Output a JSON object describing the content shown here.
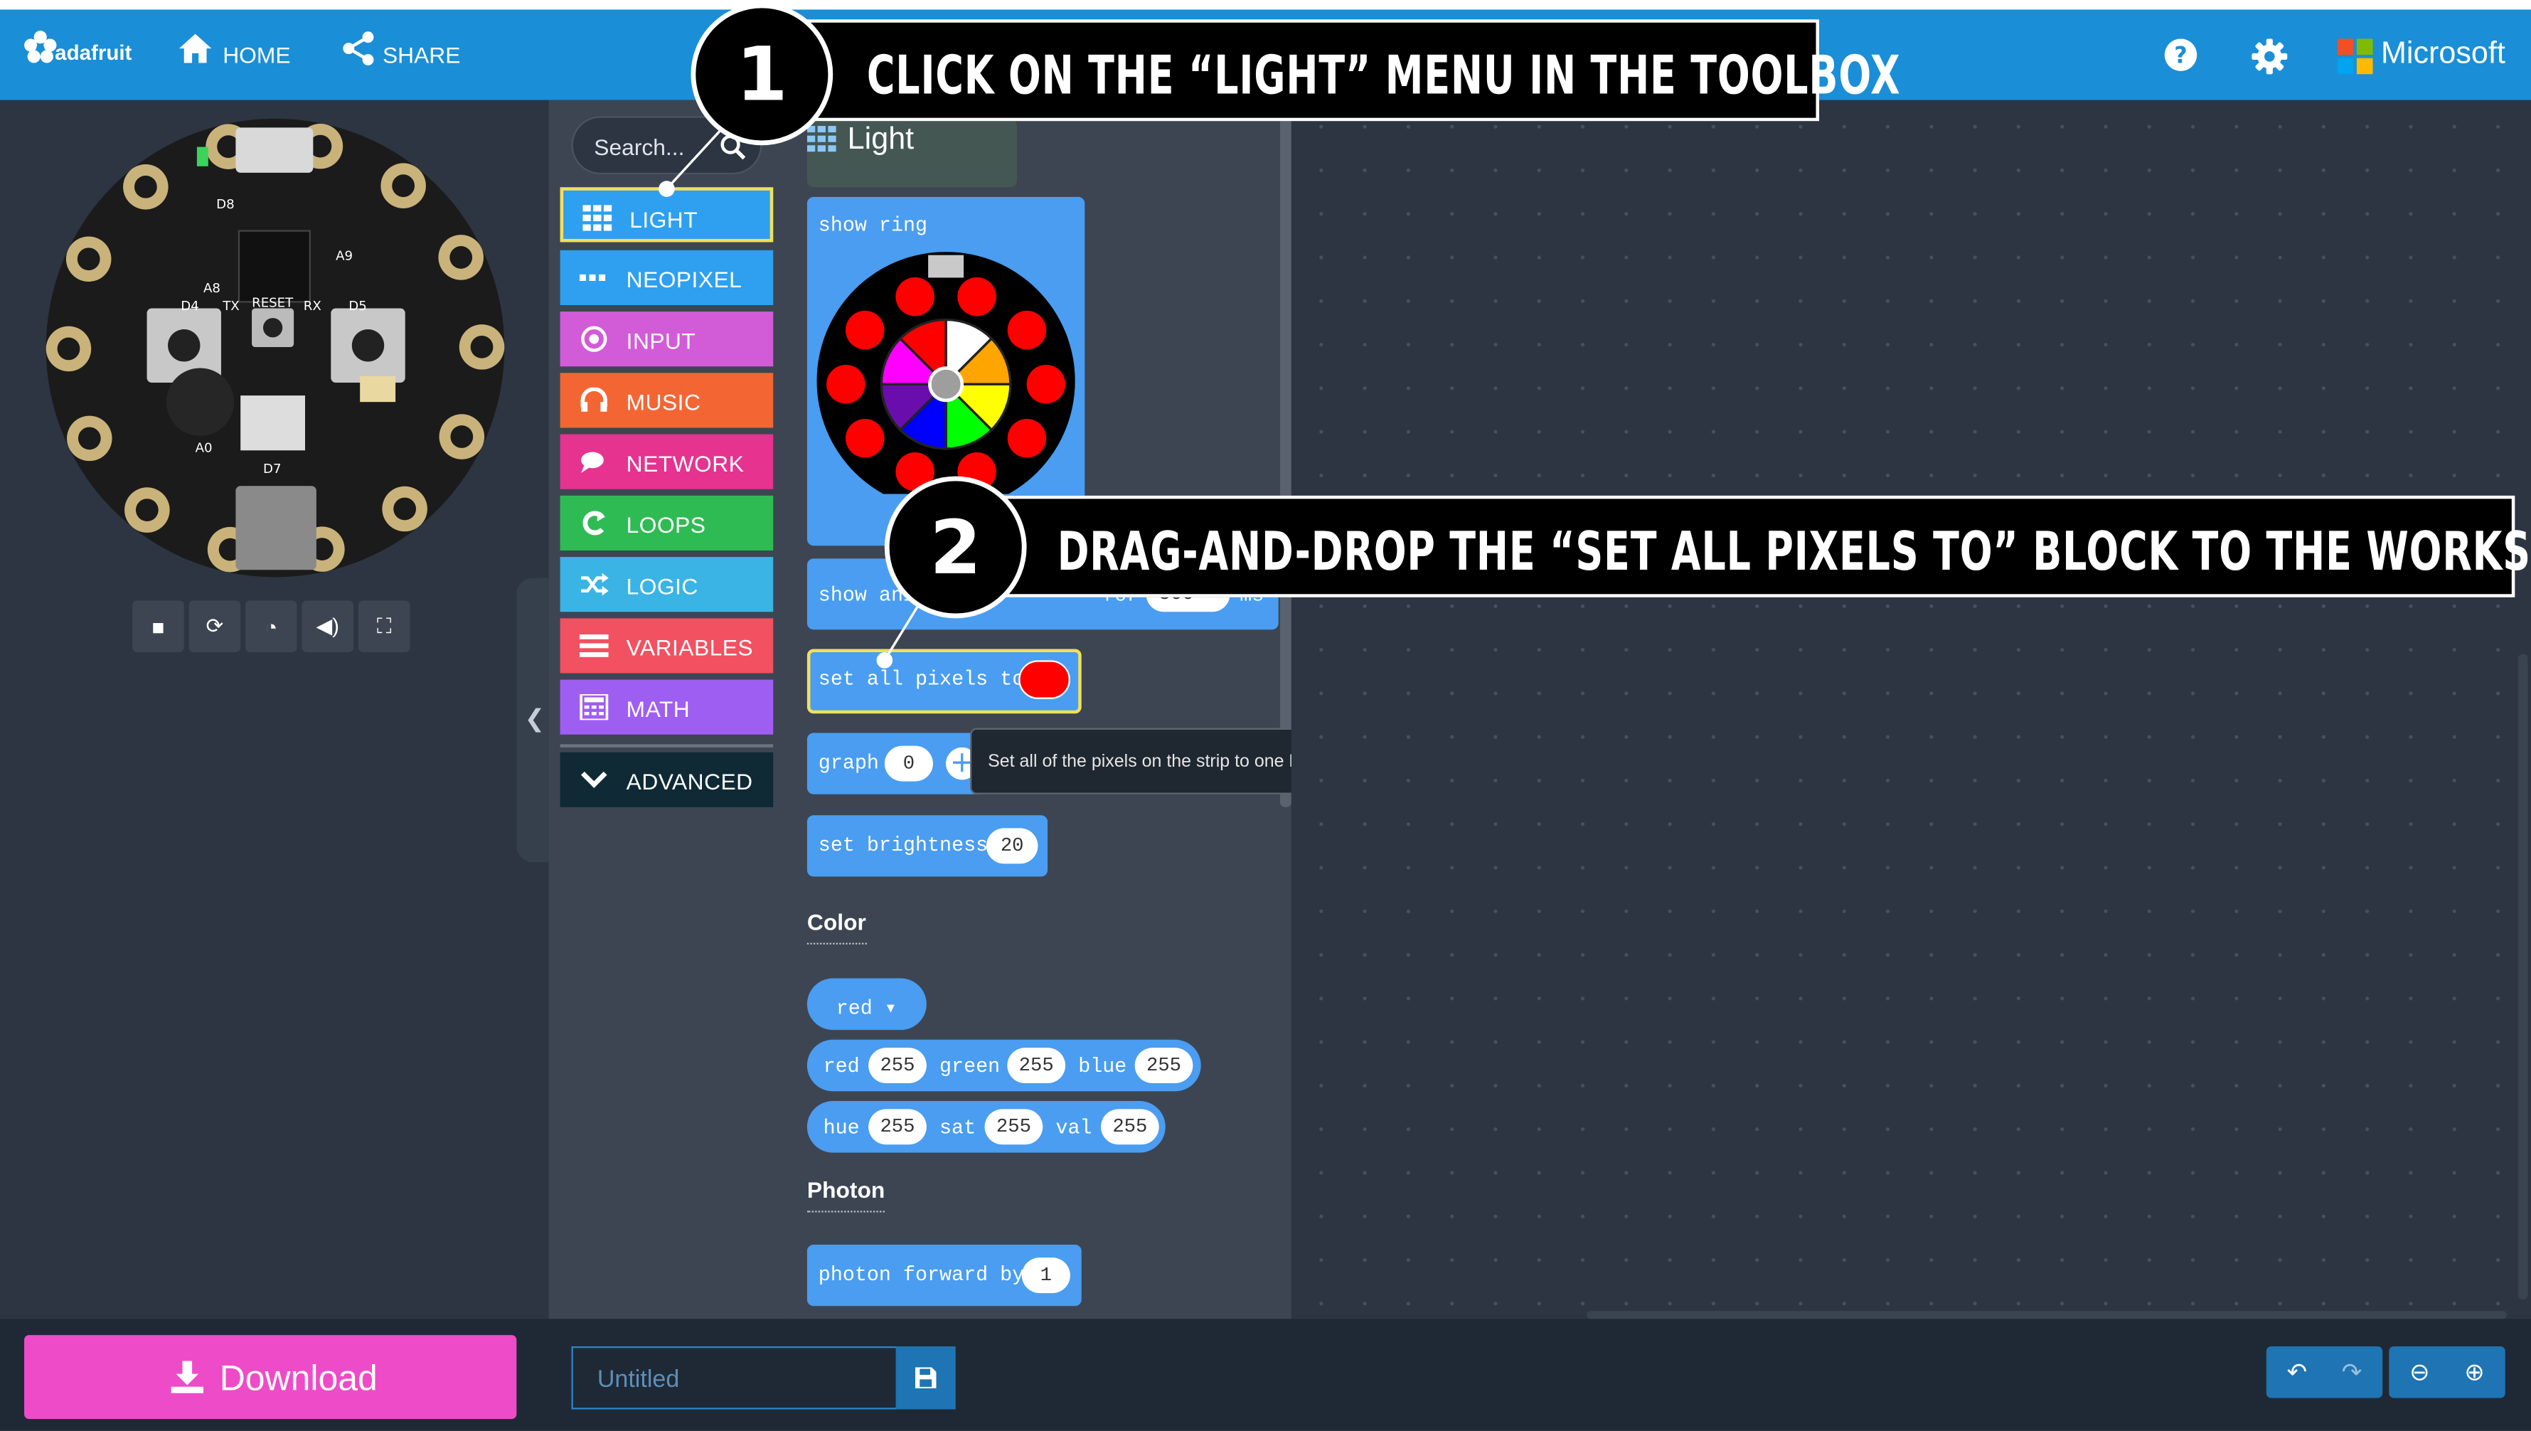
{
  "header": {
    "brand": "adafruit",
    "home_label": "HOME",
    "share_label": "SHARE",
    "microsoft_label": "Microsoft",
    "accent_color": "#1a8ed6"
  },
  "simulator": {
    "board": "Circuit Playground",
    "controls": [
      "stop-icon",
      "restart-icon",
      "slow-mo-icon",
      "mute-icon",
      "fullscreen-icon"
    ]
  },
  "toolbox": {
    "search_placeholder": "Search...",
    "categories": [
      {
        "label": "LIGHT",
        "color": "#2ea0ef",
        "icon": "grid-icon"
      },
      {
        "label": "NEOPIXEL",
        "color": "#2ea0ef",
        "icon": "dots-icon"
      },
      {
        "label": "INPUT",
        "color": "#d25bd8",
        "icon": "target-icon"
      },
      {
        "label": "MUSIC",
        "color": "#f36634",
        "icon": "headphones-icon"
      },
      {
        "label": "NETWORK",
        "color": "#e5338f",
        "icon": "chat-icon"
      },
      {
        "label": "LOOPS",
        "color": "#2fbb54",
        "icon": "loop-icon"
      },
      {
        "label": "LOGIC",
        "color": "#3ab4e4",
        "icon": "shuffle-icon"
      },
      {
        "label": "VARIABLES",
        "color": "#f25161",
        "icon": "list-icon"
      },
      {
        "label": "MATH",
        "color": "#9f5ef2",
        "icon": "calculator-icon"
      }
    ],
    "advanced_label": "ADVANCED"
  },
  "flyout": {
    "title": "Light",
    "show_ring_label": "show ring",
    "show_animation_label": "show ani",
    "show_animation_for": "for",
    "show_animation_ms": "500",
    "show_animation_unit": "ms",
    "set_all_label": "set all pixels to",
    "graph_label": "graph",
    "graph_value": "0",
    "tooltip": "Set all of the pixels on the strip to one RGB color.",
    "brightness_label": "set brightness",
    "brightness_value": "20",
    "color_heading": "Color",
    "color_dropdown": "red",
    "rgb": {
      "red_label": "red",
      "red": "255",
      "green_label": "green",
      "green": "255",
      "blue_label": "blue",
      "blue": "255"
    },
    "hsv": {
      "hue_label": "hue",
      "hue": "255",
      "sat_label": "sat",
      "sat": "255",
      "val_label": "val",
      "val": "255"
    },
    "photon_heading": "Photon",
    "photon_label": "photon forward by",
    "photon_value": "1"
  },
  "bottom": {
    "download_label": "Download",
    "project_placeholder": "Untitled"
  },
  "callouts": {
    "step1_number": "1",
    "step1_text": "Click on the “Light” menu in the toolbox",
    "step2_number": "2",
    "step2_text": "Drag-and-drop the “set all pixels to” block to the workspace"
  }
}
